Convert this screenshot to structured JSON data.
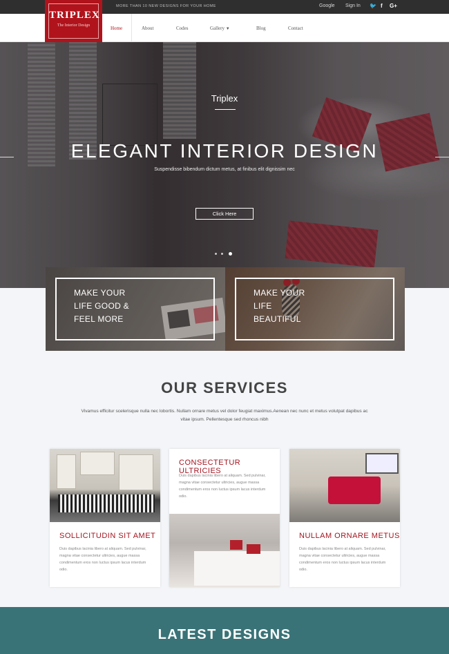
{
  "topbar": {
    "tagline": "MORE THAN 10 NEW DESIGNS FOR YOUR HOME",
    "links": [
      "Google",
      "Sign In"
    ],
    "social_icons": [
      "twitter-icon",
      "facebook-icon",
      "google-plus-icon"
    ]
  },
  "logo": {
    "title": "TRIPLEX",
    "subtitle": "The Interior Design",
    "bg_color": "#b0131b"
  },
  "nav": {
    "items": [
      "Home",
      "About",
      "Codes",
      "Gallery",
      "Blog",
      "Contact"
    ],
    "active": "Home"
  },
  "hero": {
    "small_title": "Triplex",
    "title": "ELEGANT INTERIOR DESIGN",
    "subtitle": "Suspendisse bibendum dictum metus, at finibus elit dignissim nec",
    "button": "Click Here",
    "slides": 3,
    "active_slide": 3
  },
  "features": [
    {
      "lines": [
        "MAKE YOUR",
        "LIFE GOOD &",
        "FEEL MORE"
      ]
    },
    {
      "lines": [
        "MAKE YOUR",
        "LIFE",
        "BEAUTIFUL"
      ]
    }
  ],
  "services": {
    "title": "OUR SERVICES",
    "description": "Vivamus efficitur scelerisque nulla nec lobortis. Nullam ornare metus vel dolor feugiat maximus.Aenean nec nunc et metus volutpat dapibus ac vitae ipsum. Pellentesque sed rhoncus nibh",
    "cards": [
      {
        "title": "SOLLICITUDIN SIT AMET",
        "text": "Duis dapibus lacinia libero at aliquam. Sed pulvinar, magna vitae consectetur ultricies, augue massa condimentum eros non luctus ipsum lacus interdum odio."
      },
      {
        "title": "CONSECTETUR ULTRICIES",
        "text": "Duis dapibus lacinia libero at aliquam. Sed pulvinar, magna vitae consectetur ultricies, augue massa condimentum eros non luctus ipsum lacus interdum odio."
      },
      {
        "title": "NULLAM ORNARE METUS",
        "text": "Duis dapibus lacinia libero at aliquam. Sed pulvinar, magna vitae consectetur ultricies, augue massa condimentum eros non luctus ipsum lacus interdum odio."
      }
    ],
    "accent_color": "#a4141f"
  },
  "latest": {
    "title": "LATEST DESIGNS",
    "bg_color": "#3a7377"
  }
}
